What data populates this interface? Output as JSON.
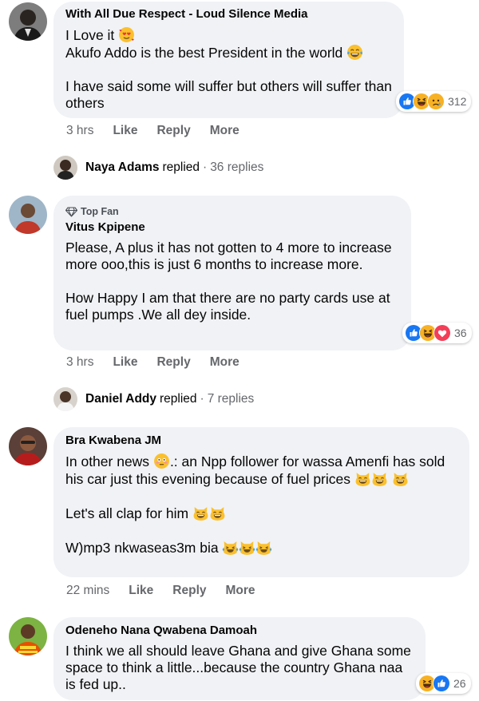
{
  "comments": [
    {
      "author": "With All Due Respect - Loud Silence Media",
      "line1": "I Love it",
      "line2": "Akufo Addo is the best President in the world",
      "line3": "I have said some will suffer but others will suffer than others",
      "time": "3 hrs",
      "like": "Like",
      "reply": "Reply",
      "more": "More",
      "reaction_count": "312",
      "reactions": [
        "like-icon",
        "haha-icon",
        "sad-icon"
      ],
      "replies": {
        "name": "Naya Adams",
        "word": "replied",
        "count": "36 replies"
      }
    },
    {
      "badge": "Top Fan",
      "author": "Vitus Kpipene",
      "line1": "Please, A plus it has not gotten to 4 more to increase more ooo,this is just 6 months to increase more.",
      "line2": "How Happy I am that there are no party cards use at fuel pumps .We all dey inside.",
      "time": "3 hrs",
      "like": "Like",
      "reply": "Reply",
      "more": "More",
      "reaction_count": "36",
      "reactions": [
        "like-icon",
        "haha-icon",
        "love-icon"
      ],
      "replies": {
        "name": "Daniel Addy",
        "word": "replied",
        "count": "7 replies"
      }
    },
    {
      "author": "Bra Kwabena JM",
      "line1a": "In other news",
      "line1b": ".: an Npp follower for wassa Amenfi has sold his car just this evening because of fuel prices",
      "line2": "Let's all clap for him",
      "line3": "W)mp3 nkwaseas3m bia",
      "time": "22 mins",
      "like": "Like",
      "reply": "Reply",
      "more": "More"
    },
    {
      "author": "Odeneho Nana Qwabena Damoah",
      "line1": "I think we all should leave Ghana and give Ghana some space to think a little...because the country Ghana naa is fed up..",
      "reaction_count": "26",
      "reactions": [
        "haha-icon",
        "like-icon"
      ]
    }
  ],
  "colors": {
    "bubble": "#f0f2f5",
    "meta": "#65676b",
    "like": "#1877f2",
    "love": "#f33e58",
    "haha": "#f7b125"
  }
}
